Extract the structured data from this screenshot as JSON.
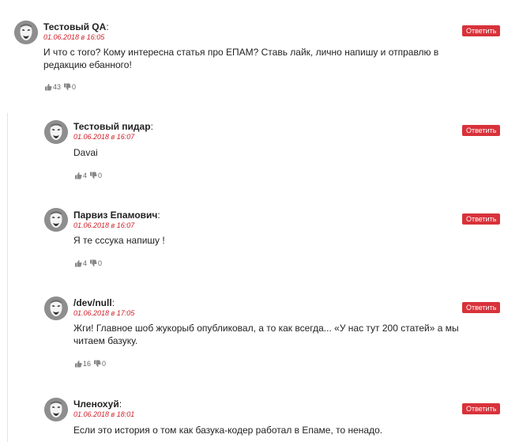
{
  "reply_label": "Ответить",
  "comments": [
    {
      "author": "Тестовый QA",
      "date": "01.06.2018 в 16:05",
      "text": "И что с того? Кому интересна статья про ЕПАМ? Ставь лайк, лично напишу и отправлю в редакцию ебанного!",
      "likes": "43",
      "dislikes": "0"
    },
    {
      "author": "Тестовый пидар",
      "date": "01.06.2018 в 16:07",
      "text": "Davai",
      "likes": "4",
      "dislikes": "0"
    },
    {
      "author": "Парвиз Епамович",
      "date": "01.06.2018 в 16:07",
      "text": "Я те сссука напишу !",
      "likes": "4",
      "dislikes": "0"
    },
    {
      "author": "/dev/null",
      "date": "01.06.2018 в 17:05",
      "text": "Жги! Главное шоб жукорыб опубликовал, а то как всегда... «У нас тут 200 статей» а мы читаем базуку.",
      "likes": "16",
      "dislikes": "0"
    },
    {
      "author": "Членохуй",
      "date": "01.06.2018 в 18:01",
      "text": "Если это история о том как базука-кодер работал в Епаме, то ненадо.",
      "likes": "",
      "dislikes": ""
    }
  ],
  "icons": {
    "like": "thumbs-up-icon",
    "dislike": "thumbs-down-icon",
    "avatar": "anonymous-mask-avatar"
  },
  "colors": {
    "accent": "#d8323a",
    "date": "#d0202a"
  }
}
